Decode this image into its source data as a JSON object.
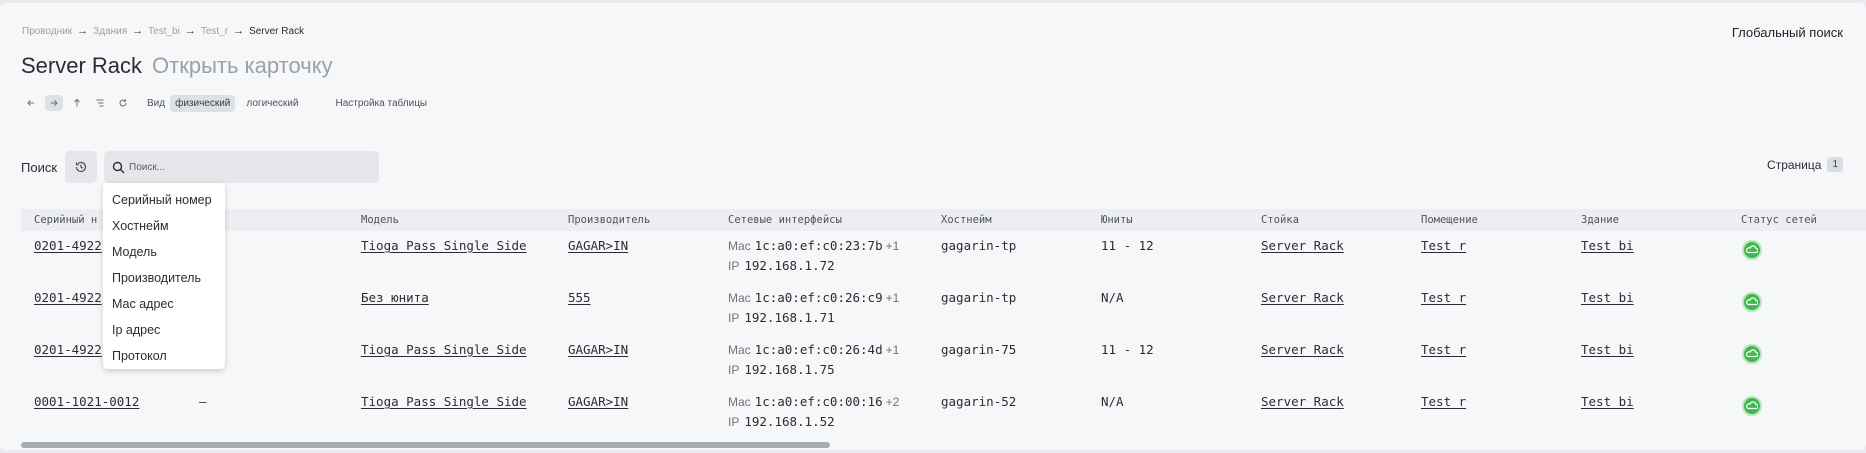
{
  "breadcrumb": {
    "items": [
      "Проводник",
      "Здания",
      "Test_bi",
      "Test_r",
      "Server Rack"
    ]
  },
  "global_search": "Глобальный поиск",
  "title": {
    "name": "Server Rack",
    "open_card": "Открыть карточку"
  },
  "toolbar": {
    "icons": [
      "arrow-left-icon",
      "arrow-right-icon",
      "arrow-up-icon",
      "tree-icon",
      "refresh-icon"
    ],
    "view_label": "Вид",
    "view_physical": "физический",
    "view_logical": "логический",
    "table_settings": "Настройка таблицы",
    "active_view": "физический"
  },
  "search": {
    "label": "Поиск",
    "placeholder": "Поиск..."
  },
  "pagination": {
    "label": "Страница",
    "page": "1"
  },
  "dropdown": {
    "items": [
      "Серийный номер",
      "Хостнейм",
      "Модель",
      "Производитель",
      "Мас адрес",
      "Ip адрес",
      "Протокол"
    ]
  },
  "table": {
    "headers": {
      "serial": "Серийный н",
      "model": "Модель",
      "vendor": "Производитель",
      "interfaces": "Сетевые интерфейсы",
      "hostname": "Хостнейм",
      "units": "Юниты",
      "rack": "Стойка",
      "room": "Помещение",
      "building": "Здание",
      "net_status": "Статус сетей"
    },
    "mac_prefix": "Mac",
    "ip_prefix": "IP",
    "rows": [
      {
        "serial": "0201-4922",
        "col2": "",
        "model": "Tioga Pass Single Side",
        "vendor": "GAGAR>IN",
        "mac": "1c:a0:ef:c0:23:7b",
        "mac_more": "+1",
        "ip": "192.168.1.72",
        "hostname": "gagarin-tp",
        "units": "11 - 12",
        "rack": "Server Rack",
        "room": "Test r",
        "building": "Test bi",
        "status": "online"
      },
      {
        "serial": "0201-4922",
        "col2": "",
        "model": "Без юнита",
        "vendor": "555",
        "mac": "1c:a0:ef:c0:26:c9",
        "mac_more": "+1",
        "ip": "192.168.1.71",
        "hostname": "gagarin-tp",
        "units": "N/A",
        "rack": "Server Rack",
        "room": "Test r",
        "building": "Test bi",
        "status": "online"
      },
      {
        "serial": "0201-4922",
        "col2": "",
        "model": "Tioga Pass Single Side",
        "vendor": "GAGAR>IN",
        "mac": "1c:a0:ef:c0:26:4d",
        "mac_more": "+1",
        "ip": "192.168.1.75",
        "hostname": "gagarin-75",
        "units": "11 - 12",
        "rack": "Server Rack",
        "room": "Test r",
        "building": "Test bi",
        "status": "online"
      },
      {
        "serial": "0001-1021-0012",
        "col2": "—",
        "model": "Tioga Pass Single Side",
        "vendor": "GAGAR>IN",
        "mac": "1c:a0:ef:c0:00:16",
        "mac_more": "+2",
        "ip": "192.168.1.52",
        "hostname": "gagarin-52",
        "units": "N/A",
        "rack": "Server Rack",
        "room": "Test r",
        "building": "Test bi",
        "status": "online"
      }
    ]
  },
  "colors": {
    "status_online": "#3fb84e",
    "background": "#f6f7f9"
  }
}
